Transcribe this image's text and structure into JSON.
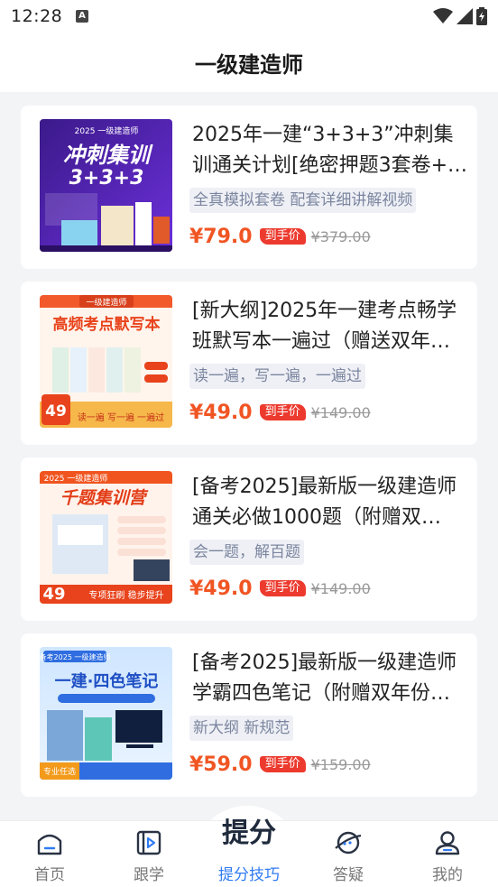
{
  "status": {
    "time": "12:28",
    "badge": "A"
  },
  "header": {
    "title": "一级建造师"
  },
  "products": [
    {
      "title": "2025年一建“3+3+3”冲刺集训通关计划[绝密押题3套卷+…",
      "tag": "全真模拟套卷 配套详细讲解视频",
      "price": "¥79.0",
      "price_badge": "到手价",
      "orig_price": "¥379.00",
      "cover": {
        "top": "2025 一级建造师",
        "main": "冲刺集训",
        "sub": "3+3+3"
      }
    },
    {
      "title": "[新大纲]2025年一建考点畅学班默写本一遍过（赠送双年…",
      "tag": "读一遍，写一遍，一遍过",
      "price": "¥49.0",
      "price_badge": "到手价",
      "orig_price": "¥149.00",
      "cover": {
        "top": "一级建造师",
        "main": "高频考点默写本",
        "sub": "读一遍 写一遍 一遍过",
        "corner": "49"
      }
    },
    {
      "title": "[备考2025]最新版一级建造师通关必做1000题（附赠双…",
      "tag": "会一题，解百题",
      "price": "¥49.0",
      "price_badge": "到手价",
      "orig_price": "¥149.00",
      "cover": {
        "top": "2025 一级建造师",
        "main": "千题集训营",
        "sub": "专项狂刷 稳步提升",
        "corner": "49"
      }
    },
    {
      "title": "[备考2025]最新版一级建造师学霸四色笔记（附赠双年份…",
      "tag": "新大纲 新规范",
      "price": "¥59.0",
      "price_badge": "到手价",
      "orig_price": "¥159.00",
      "cover": {
        "top": "备考2025 一级建造师",
        "main": "一建·四色笔记",
        "sub": "专业任选"
      }
    }
  ],
  "tabbar": {
    "items": [
      {
        "label": "首页",
        "icon": "home-icon"
      },
      {
        "label": "跟学",
        "icon": "play-book-icon"
      },
      {
        "label": "提分技巧",
        "icon": "tifen-logo",
        "logo_text": "提分",
        "active": true
      },
      {
        "label": "答疑",
        "icon": "chat-planet-icon"
      },
      {
        "label": "我的",
        "icon": "user-icon"
      }
    ],
    "active_color": "#2f7bf2"
  },
  "colors": {
    "price": "#f05523",
    "badge": "#ec3a2e",
    "tag_bg": "#eef0f5"
  }
}
